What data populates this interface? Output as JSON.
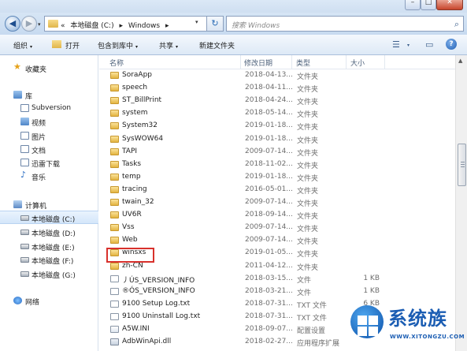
{
  "window": {
    "min_glyph": "–",
    "max_glyph": "□",
    "close_glyph": "✕"
  },
  "nav": {
    "back_glyph": "◀",
    "forward_glyph": "▶",
    "history_glyph": "▾",
    "address_prefix": "«",
    "address_parts": [
      "本地磁盘 (C:)",
      "▸",
      "Windows",
      "▸"
    ],
    "address_drop": "▾",
    "refresh_glyph": "↻",
    "search_placeholder": "搜索 Windows",
    "search_glyph": "⌕"
  },
  "toolbar": {
    "organize": "组织",
    "open": "打开",
    "include_library": "包含到库中",
    "share": "共享",
    "new_folder": "新建文件夹",
    "caret": "▾",
    "view_glyph": "☰",
    "pane_glyph": "▭",
    "help_glyph": "?"
  },
  "columns": {
    "name": "名称",
    "date": "修改日期",
    "type": "类型",
    "size": "大小"
  },
  "sidebar": [
    {
      "label": "收藏夹",
      "icon": "star-icon"
    },
    {
      "label": "库",
      "icon": "library-icon"
    },
    {
      "label": "Subversion",
      "icon": "subversion-library-icon"
    },
    {
      "label": "视频",
      "icon": "video-library-icon"
    },
    {
      "label": "图片",
      "icon": "picture-library-icon"
    },
    {
      "label": "文档",
      "icon": "document-library-icon"
    },
    {
      "label": "迅雷下载",
      "icon": "download-library-icon"
    },
    {
      "label": "音乐",
      "icon": "music-icon"
    },
    {
      "label": "计算机",
      "icon": "computer-icon"
    },
    {
      "label": "本地磁盘 (C:)",
      "icon": "drive-icon"
    },
    {
      "label": "本地磁盘 (D:)",
      "icon": "drive-icon"
    },
    {
      "label": "本地磁盘 (E:)",
      "icon": "drive-icon"
    },
    {
      "label": "本地磁盘 (F:)",
      "icon": "drive-icon"
    },
    {
      "label": "本地磁盘 (G:)",
      "icon": "drive-icon"
    },
    {
      "label": "网络",
      "icon": "network-icon"
    }
  ],
  "files": [
    {
      "name": "SoraApp",
      "date": "2018-04-13...",
      "type": "文件夹",
      "size": "",
      "kind": "folder"
    },
    {
      "name": "speech",
      "date": "2018-04-11...",
      "type": "文件夹",
      "size": "",
      "kind": "folder"
    },
    {
      "name": "ST_BillPrint",
      "date": "2018-04-24...",
      "type": "文件夹",
      "size": "",
      "kind": "folder"
    },
    {
      "name": "system",
      "date": "2018-05-14...",
      "type": "文件夹",
      "size": "",
      "kind": "folder"
    },
    {
      "name": "System32",
      "date": "2019-01-18...",
      "type": "文件夹",
      "size": "",
      "kind": "folder"
    },
    {
      "name": "SysWOW64",
      "date": "2019-01-18...",
      "type": "文件夹",
      "size": "",
      "kind": "folder"
    },
    {
      "name": "TAPI",
      "date": "2009-07-14...",
      "type": "文件夹",
      "size": "",
      "kind": "folder"
    },
    {
      "name": "Tasks",
      "date": "2018-11-02...",
      "type": "文件夹",
      "size": "",
      "kind": "folder"
    },
    {
      "name": "temp",
      "date": "2019-01-18...",
      "type": "文件夹",
      "size": "",
      "kind": "folder"
    },
    {
      "name": "tracing",
      "date": "2016-05-01...",
      "type": "文件夹",
      "size": "",
      "kind": "folder"
    },
    {
      "name": "twain_32",
      "date": "2009-07-14...",
      "type": "文件夹",
      "size": "",
      "kind": "folder"
    },
    {
      "name": "UV6R",
      "date": "2018-09-14...",
      "type": "文件夹",
      "size": "",
      "kind": "folder"
    },
    {
      "name": "Vss",
      "date": "2009-07-14...",
      "type": "文件夹",
      "size": "",
      "kind": "folder"
    },
    {
      "name": "Web",
      "date": "2009-07-14...",
      "type": "文件夹",
      "size": "",
      "kind": "folder"
    },
    {
      "name": "winsxs",
      "date": "2019-01-05...",
      "type": "文件夹",
      "size": "",
      "kind": "folder"
    },
    {
      "name": "zh-CN",
      "date": "2011-04-12...",
      "type": "文件夹",
      "size": "",
      "kind": "folder"
    },
    {
      "name": "丿ÚS_VERSION_INFO",
      "date": "2018-03-15...",
      "type": "文件",
      "size": "1 KB",
      "kind": "txt"
    },
    {
      "name": "®ÓS_VERSION_INFO",
      "date": "2018-03-21...",
      "type": "文件",
      "size": "1 KB",
      "kind": "txt"
    },
    {
      "name": "9100 Setup Log.txt",
      "date": "2018-07-31...",
      "type": "TXT 文件",
      "size": "6 KB",
      "kind": "txt"
    },
    {
      "name": "9100 Uninstall Log.txt",
      "date": "2018-07-31...",
      "type": "TXT 文件",
      "size": "",
      "kind": "txt"
    },
    {
      "name": "A5W.INI",
      "date": "2018-09-07...",
      "type": "配置设置",
      "size": "",
      "kind": "ini"
    },
    {
      "name": "AdbWinApi.dll",
      "date": "2018-02-27...",
      "type": "应用程序扩展",
      "size": "",
      "kind": "dll"
    }
  ],
  "watermark": {
    "title": "系统族",
    "url": "WWW.XITONGZU.COM"
  }
}
